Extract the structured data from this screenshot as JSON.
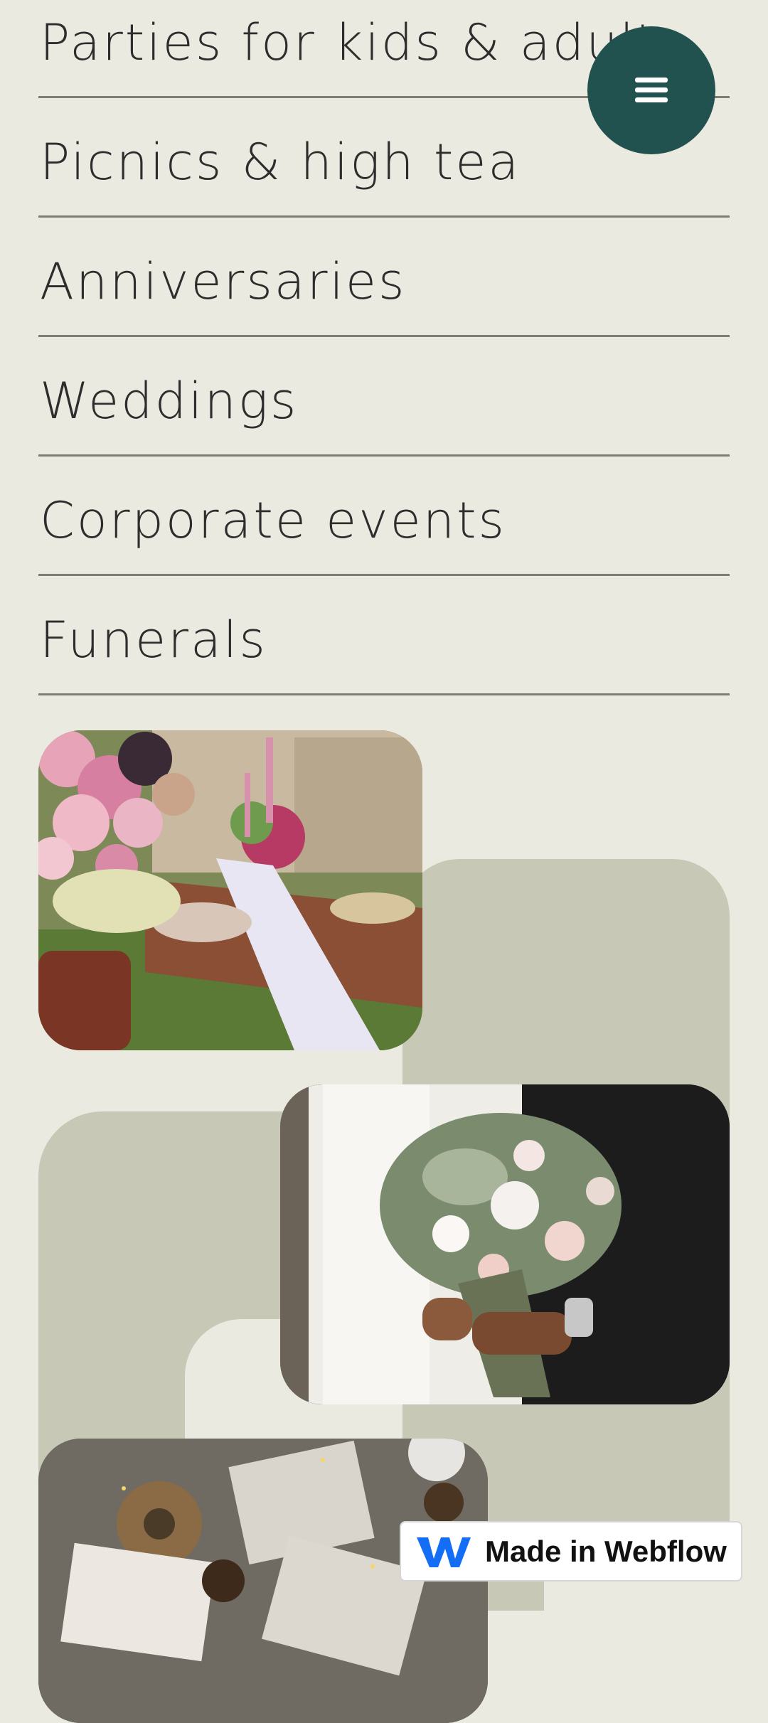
{
  "services": [
    {
      "label": "Parties for kids & adults"
    },
    {
      "label": "Picnics & high tea"
    },
    {
      "label": "Anniversaries"
    },
    {
      "label": "Weddings"
    },
    {
      "label": "Corporate events"
    },
    {
      "label": "Funerals"
    }
  ],
  "menu_button": {
    "icon": "hamburger-menu-icon"
  },
  "images": [
    {
      "name": "picnic-table-photo"
    },
    {
      "name": "wedding-bouquet-photo"
    },
    {
      "name": "gift-wrapping-photo"
    }
  ],
  "webflow_badge": {
    "label": "Made in Webflow",
    "icon": "webflow-logo-icon"
  },
  "colors": {
    "background": "#ebeae1",
    "accent": "#22524f",
    "shape": "#c8c8b7"
  }
}
